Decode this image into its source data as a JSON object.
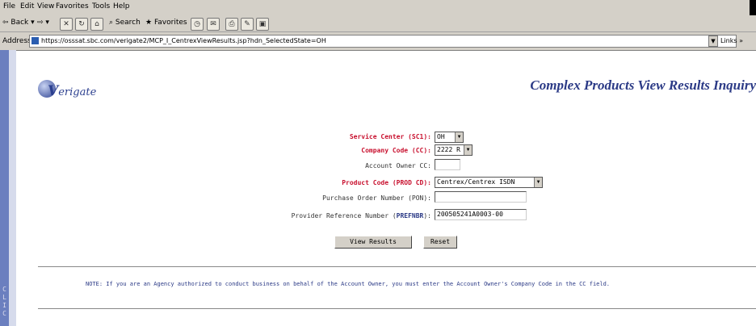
{
  "browser": {
    "menu": [
      "File",
      "Edit",
      "View",
      "Favorites",
      "Tools",
      "Help"
    ],
    "toolbar": {
      "back": "Back",
      "search": "Search",
      "favorites": "Favorites"
    },
    "address_label": "Address",
    "url": "https://osssat.sbc.com/verigate2/MCP_I_CentrexViewResults.jsp?hdn_SelectedState=OH",
    "links_label": "Links"
  },
  "page": {
    "logo_text": "erigate",
    "title": "Complex Products View Results Inquiry",
    "sidebar_letters": "C\nL\nI\nC"
  },
  "form": {
    "service_center": {
      "label": "Service Center (SC1):",
      "value": "OH"
    },
    "company_code": {
      "label": "Company Code (CC):",
      "value": "2222 R"
    },
    "account_owner_cc": {
      "label": "Account Owner CC:",
      "value": ""
    },
    "product_code": {
      "label": "Product Code (PROD CD):",
      "value": "Centrex/Centrex ISDN"
    },
    "purchase_order": {
      "label": "Purchase Order Number (PON):",
      "value": ""
    },
    "provider_ref": {
      "label_pre": "Provider Reference Number (",
      "label_bold": "PREFNBR",
      "label_post": "):",
      "value": "200505241A0003-00"
    },
    "view_results_button": "View Results",
    "reset_button": "Reset"
  },
  "note": "NOTE: If you are an Agency authorized to conduct business on behalf of the Account Owner, you must enter the Account Owner's Company Code in the CC field."
}
